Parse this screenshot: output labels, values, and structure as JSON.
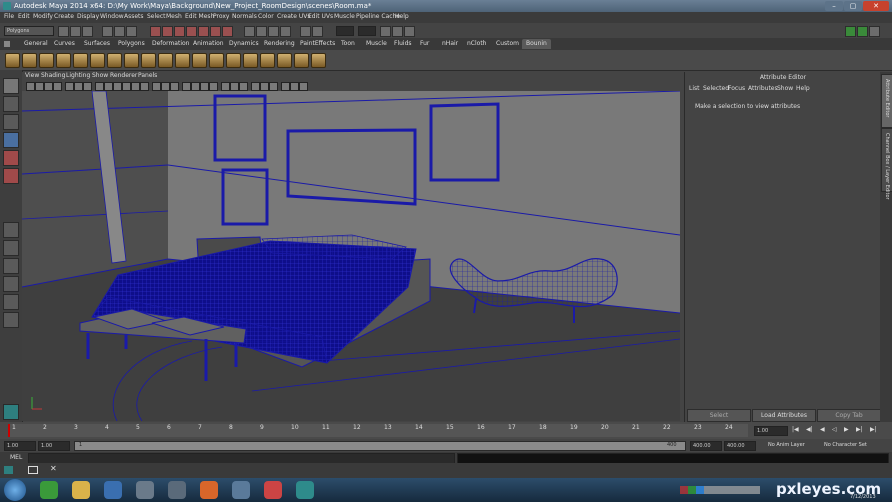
{
  "window": {
    "title": "Autodesk Maya 2014 x64: D:\\My Work\\Maya\\Background\\New_Project_RoomDesign\\scenes\\Room.ma*"
  },
  "menu": [
    "File",
    "Edit",
    "Modify",
    "Create",
    "Display",
    "Window",
    "Assets",
    "Select",
    "Mesh",
    "Edit Mesh",
    "Proxy",
    "Normals",
    "Color",
    "Create UVs",
    "Edit UVs",
    "Muscle",
    "Pipeline Cache",
    "Help"
  ],
  "status": {
    "mode": "Polygons"
  },
  "shelf_tabs": [
    "General",
    "Curves",
    "Surfaces",
    "Polygons",
    "Deformation",
    "Animation",
    "Dynamics",
    "Rendering",
    "PaintEffects",
    "Toon",
    "Muscle",
    "Fluids",
    "Fur",
    "nHair",
    "nCloth",
    "Custom",
    "Bounin"
  ],
  "active_shelf_tab": "Bounin",
  "viewport_menu": [
    "View",
    "Shading",
    "Lighting",
    "Show",
    "Renderer",
    "Panels"
  ],
  "attribute_editor": {
    "title": "Attribute Editor",
    "menu": [
      "List",
      "Selected",
      "Focus",
      "Attributes",
      "Show",
      "Help"
    ],
    "message": "Make a selection to view attributes",
    "buttons": [
      "Select",
      "Load Attributes",
      "Copy Tab"
    ]
  },
  "side_tabs": [
    "Attribute Editor",
    "Channel Box / Layer Editor"
  ],
  "timeline": {
    "ticks": [
      "1",
      "2",
      "3",
      "4",
      "5",
      "6",
      "7",
      "8",
      "9",
      "10",
      "11",
      "12",
      "13",
      "14",
      "15",
      "16",
      "17",
      "18",
      "19",
      "20",
      "21",
      "22",
      "23",
      "24"
    ],
    "current": "1.00"
  },
  "range": {
    "start": "1.00",
    "start2": "1.00",
    "marker": "1",
    "end_marker": "400",
    "end": "400.00",
    "end2": "400.00",
    "anim_layer": "No Anim Layer",
    "char_set": "No Character Set"
  },
  "command": {
    "label": "MEL"
  },
  "taskbar": {
    "date": "7/12/2013"
  },
  "watermark": "pxleyes.com",
  "colors": {
    "wire": "#1a1aa8",
    "viewport_bg": "#3c3c3c",
    "accent": "#6a7f95"
  }
}
